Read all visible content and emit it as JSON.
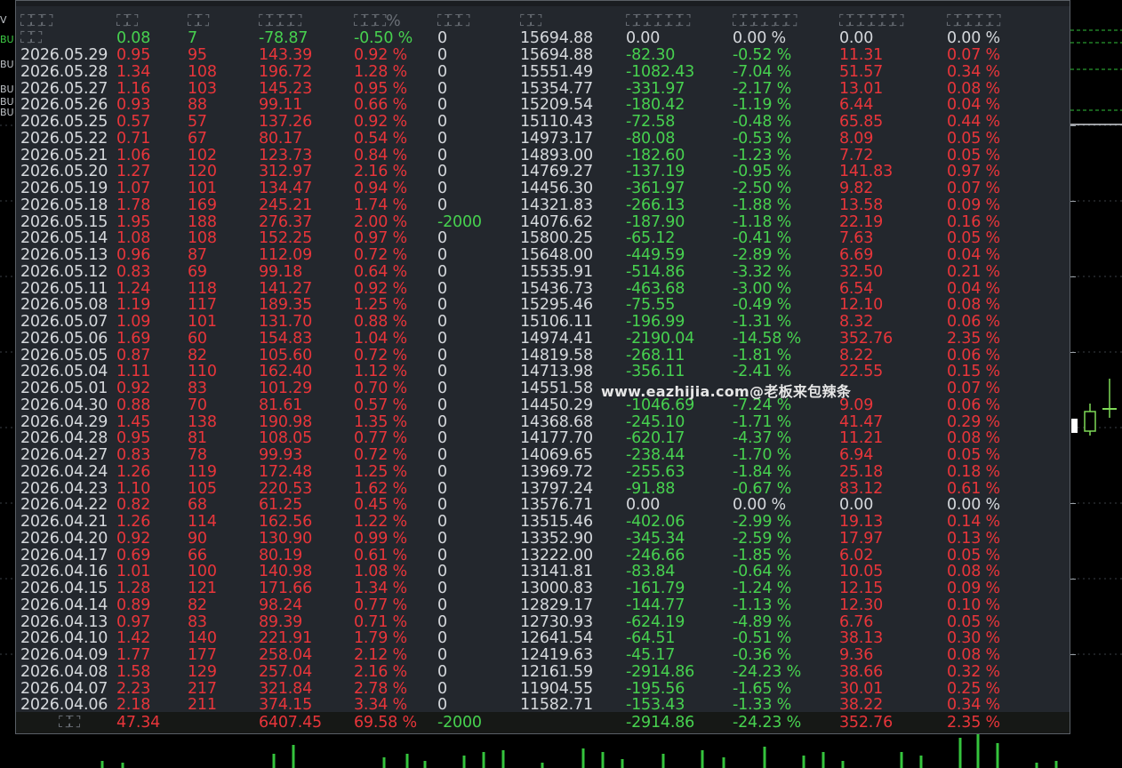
{
  "panel": {
    "header": {
      "date": "⛶⛶⛶",
      "c1": "⛶⛶",
      "c2": "⛶⛶",
      "c3": "⛶⛶⛶⛶",
      "c4": "⛶⛶⛶%",
      "c5": "⛶⛶⛶",
      "c6": "⛶⛶",
      "c7": "⛶⛶⛶⛶⛶⛶",
      "c8": "⛶⛶⛶⛶⛶⛶",
      "c9": "⛶⛶⛶⛶⛶⛶",
      "c10": "⛶⛶⛶⛶⛶"
    },
    "summary": {
      "date": "⛶⛶",
      "c1": "0.08",
      "c2": "7",
      "c3": "-78.87",
      "c4": "-0.50 %",
      "c5": "0",
      "c6": "15694.88",
      "c7": "0.00",
      "c8": "0.00 %",
      "c9": "0.00",
      "c10": "0.00 %"
    },
    "rows": [
      [
        "2026.05.29",
        "0.95",
        "95",
        "143.39",
        "0.92 %",
        "0",
        "15694.88",
        "-82.30",
        "-0.52 %",
        "11.31",
        "0.07 %"
      ],
      [
        "2026.05.28",
        "1.34",
        "108",
        "196.72",
        "1.28 %",
        "0",
        "15551.49",
        "-1082.43",
        "-7.04 %",
        "51.57",
        "0.34 %"
      ],
      [
        "2026.05.27",
        "1.16",
        "103",
        "145.23",
        "0.95 %",
        "0",
        "15354.77",
        "-331.97",
        "-2.17 %",
        "13.01",
        "0.08 %"
      ],
      [
        "2026.05.26",
        "0.93",
        "88",
        "99.11",
        "0.66 %",
        "0",
        "15209.54",
        "-180.42",
        "-1.19 %",
        "6.44",
        "0.04 %"
      ],
      [
        "2026.05.25",
        "0.57",
        "57",
        "137.26",
        "0.92 %",
        "0",
        "15110.43",
        "-72.58",
        "-0.48 %",
        "65.85",
        "0.44 %"
      ],
      [
        "2026.05.22",
        "0.71",
        "67",
        "80.17",
        "0.54 %",
        "0",
        "14973.17",
        "-80.08",
        "-0.53 %",
        "8.09",
        "0.05 %"
      ],
      [
        "2026.05.21",
        "1.06",
        "102",
        "123.73",
        "0.84 %",
        "0",
        "14893.00",
        "-182.60",
        "-1.23 %",
        "7.72",
        "0.05 %"
      ],
      [
        "2026.05.20",
        "1.27",
        "120",
        "312.97",
        "2.16 %",
        "0",
        "14769.27",
        "-137.19",
        "-0.95 %",
        "141.83",
        "0.97 %"
      ],
      [
        "2026.05.19",
        "1.07",
        "101",
        "134.47",
        "0.94 %",
        "0",
        "14456.30",
        "-361.97",
        "-2.50 %",
        "9.82",
        "0.07 %"
      ],
      [
        "2026.05.18",
        "1.78",
        "169",
        "245.21",
        "1.74 %",
        "0",
        "14321.83",
        "-266.13",
        "-1.88 %",
        "13.58",
        "0.09 %"
      ],
      [
        "2026.05.15",
        "1.95",
        "188",
        "276.37",
        "2.00 %",
        "-2000",
        "14076.62",
        "-187.90",
        "-1.18 %",
        "22.19",
        "0.16 %"
      ],
      [
        "2026.05.14",
        "1.08",
        "108",
        "152.25",
        "0.97 %",
        "0",
        "15800.25",
        "-65.12",
        "-0.41 %",
        "7.63",
        "0.05 %"
      ],
      [
        "2026.05.13",
        "0.96",
        "87",
        "112.09",
        "0.72 %",
        "0",
        "15648.00",
        "-449.59",
        "-2.89 %",
        "6.69",
        "0.04 %"
      ],
      [
        "2026.05.12",
        "0.83",
        "69",
        "99.18",
        "0.64 %",
        "0",
        "15535.91",
        "-514.86",
        "-3.32 %",
        "32.50",
        "0.21 %"
      ],
      [
        "2026.05.11",
        "1.24",
        "118",
        "141.27",
        "0.92 %",
        "0",
        "15436.73",
        "-463.68",
        "-3.00 %",
        "6.54",
        "0.04 %"
      ],
      [
        "2026.05.08",
        "1.19",
        "117",
        "189.35",
        "1.25 %",
        "0",
        "15295.46",
        "-75.55",
        "-0.49 %",
        "12.10",
        "0.08 %"
      ],
      [
        "2026.05.07",
        "1.09",
        "101",
        "131.70",
        "0.88 %",
        "0",
        "15106.11",
        "-196.99",
        "-1.31 %",
        "8.32",
        "0.06 %"
      ],
      [
        "2026.05.06",
        "1.69",
        "60",
        "154.83",
        "1.04 %",
        "0",
        "14974.41",
        "-2190.04",
        "-14.58 %",
        "352.76",
        "2.35 %"
      ],
      [
        "2026.05.05",
        "0.87",
        "82",
        "105.60",
        "0.72 %",
        "0",
        "14819.58",
        "-268.11",
        "-1.81 %",
        "8.22",
        "0.06 %"
      ],
      [
        "2026.05.04",
        "1.11",
        "110",
        "162.40",
        "1.12 %",
        "0",
        "14713.98",
        "-356.11",
        "-2.41 %",
        "22.55",
        "0.15 %"
      ],
      [
        "2026.05.01",
        "0.92",
        "83",
        "101.29",
        "0.70 %",
        "0",
        "14551.58",
        "",
        "",
        "",
        "0.07 %"
      ],
      [
        "2026.04.30",
        "0.88",
        "70",
        "81.61",
        "0.57 %",
        "0",
        "14450.29",
        "-1046.69",
        "-7.24 %",
        "9.09",
        "0.06 %"
      ],
      [
        "2026.04.29",
        "1.45",
        "138",
        "190.98",
        "1.35 %",
        "0",
        "14368.68",
        "-245.10",
        "-1.71 %",
        "41.47",
        "0.29 %"
      ],
      [
        "2026.04.28",
        "0.95",
        "81",
        "108.05",
        "0.77 %",
        "0",
        "14177.70",
        "-620.17",
        "-4.37 %",
        "11.21",
        "0.08 %"
      ],
      [
        "2026.04.27",
        "0.83",
        "78",
        "99.93",
        "0.72 %",
        "0",
        "14069.65",
        "-238.44",
        "-1.70 %",
        "6.94",
        "0.05 %"
      ],
      [
        "2026.04.24",
        "1.26",
        "119",
        "172.48",
        "1.25 %",
        "0",
        "13969.72",
        "-255.63",
        "-1.84 %",
        "25.18",
        "0.18 %"
      ],
      [
        "2026.04.23",
        "1.10",
        "105",
        "220.53",
        "1.62 %",
        "0",
        "13797.24",
        "-91.88",
        "-0.67 %",
        "83.12",
        "0.61 %"
      ],
      [
        "2026.04.22",
        "0.82",
        "68",
        "61.25",
        "0.45 %",
        "0",
        "13576.71",
        "0.00",
        "0.00 %",
        "0.00",
        "0.00 %"
      ],
      [
        "2026.04.21",
        "1.26",
        "114",
        "162.56",
        "1.22 %",
        "0",
        "13515.46",
        "-402.06",
        "-2.99 %",
        "19.13",
        "0.14 %"
      ],
      [
        "2026.04.20",
        "0.92",
        "90",
        "130.90",
        "0.99 %",
        "0",
        "13352.90",
        "-345.34",
        "-2.59 %",
        "17.97",
        "0.13 %"
      ],
      [
        "2026.04.17",
        "0.69",
        "66",
        "80.19",
        "0.61 %",
        "0",
        "13222.00",
        "-246.66",
        "-1.85 %",
        "6.02",
        "0.05 %"
      ],
      [
        "2026.04.16",
        "1.01",
        "100",
        "140.98",
        "1.08 %",
        "0",
        "13141.81",
        "-83.84",
        "-0.64 %",
        "10.05",
        "0.08 %"
      ],
      [
        "2026.04.15",
        "1.28",
        "121",
        "171.66",
        "1.34 %",
        "0",
        "13000.83",
        "-161.79",
        "-1.24 %",
        "12.15",
        "0.09 %"
      ],
      [
        "2026.04.14",
        "0.89",
        "82",
        "98.24",
        "0.77 %",
        "0",
        "12829.17",
        "-144.77",
        "-1.13 %",
        "12.30",
        "0.10 %"
      ],
      [
        "2026.04.13",
        "0.97",
        "83",
        "89.39",
        "0.71 %",
        "0",
        "12730.93",
        "-624.19",
        "-4.89 %",
        "6.76",
        "0.05 %"
      ],
      [
        "2026.04.10",
        "1.42",
        "140",
        "221.91",
        "1.79 %",
        "0",
        "12641.54",
        "-64.51",
        "-0.51 %",
        "38.13",
        "0.30 %"
      ],
      [
        "2026.04.09",
        "1.77",
        "177",
        "258.04",
        "2.12 %",
        "0",
        "12419.63",
        "-45.17",
        "-0.36 %",
        "9.36",
        "0.08 %"
      ],
      [
        "2026.04.08",
        "1.58",
        "129",
        "257.04",
        "2.16 %",
        "0",
        "12161.59",
        "-2914.86",
        "-24.23 %",
        "38.66",
        "0.32 %"
      ],
      [
        "2026.04.07",
        "2.23",
        "217",
        "321.84",
        "2.78 %",
        "0",
        "11904.55",
        "-195.56",
        "-1.65 %",
        "30.01",
        "0.25 %"
      ],
      [
        "2026.04.06",
        "2.18",
        "211",
        "374.15",
        "3.34 %",
        "0",
        "11582.71",
        "-153.43",
        "-1.33 %",
        "38.22",
        "0.34 %"
      ]
    ],
    "total": {
      "date": "⛶⛶",
      "c1": "47.34",
      "c3": "6407.45",
      "c4": "69.58 %",
      "c5": "-2000",
      "c7": "-2914.86",
      "c8": "-24.23 %",
      "c9": "352.76",
      "c10": "2.35 %"
    }
  },
  "watermark": "www.eazhijia.com@老板来包辣条",
  "edge_labels": [
    "V",
    "BU",
    "BU",
    "BU",
    "BU",
    "BU"
  ],
  "colors": {
    "panel_bg": "#23272d",
    "positive": "#e8353a",
    "negative": "#47d14f",
    "neutral": "#d5d8dc"
  }
}
